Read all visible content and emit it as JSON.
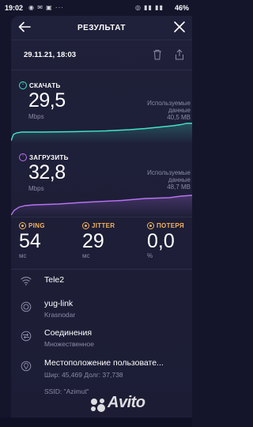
{
  "status_bar": {
    "time": "19:02",
    "left_icons": "◉ ✉ ▣ ···",
    "right_icons": "◎ ▮▮ ▮▮",
    "battery": "46%"
  },
  "header": {
    "title": "РЕЗУЛЬТАТ",
    "back_icon": "arrow-left-icon",
    "close_icon": "close-icon"
  },
  "test": {
    "date": "29.11.21, 18:03"
  },
  "download": {
    "label": "СКАЧАТЬ",
    "value": "29,5",
    "unit": "Mbps",
    "used_label_1": "Используемые",
    "used_label_2": "данные",
    "used_value": "40,5 MB",
    "color": "#41e3c8"
  },
  "upload": {
    "label": "ЗАГРУЗИТЬ",
    "value": "32,8",
    "unit": "Mbps",
    "used_label_1": "Используемые",
    "used_label_2": "данные",
    "used_value": "48,7 MB",
    "color": "#b872f2"
  },
  "ping": {
    "label": "PING",
    "value": "54",
    "unit": "мс"
  },
  "jitter": {
    "label": "JITTER",
    "value": "29",
    "unit": "мс"
  },
  "loss": {
    "label": "ПОТЕРЯ",
    "value": "0,0",
    "unit": "%"
  },
  "accent_color": "#f4b35e",
  "info": {
    "provider": "Tele2",
    "server_name": "yug-link",
    "server_city": "Krasnodar",
    "connections_label": "Соединения",
    "connections_value": "Множественное",
    "location_label": "Местоположение пользовате...",
    "location_value": "Шир: 45,469 Долг: 37,738",
    "ssid": "SSID: \"Azimut\""
  },
  "watermark": "Avito"
}
